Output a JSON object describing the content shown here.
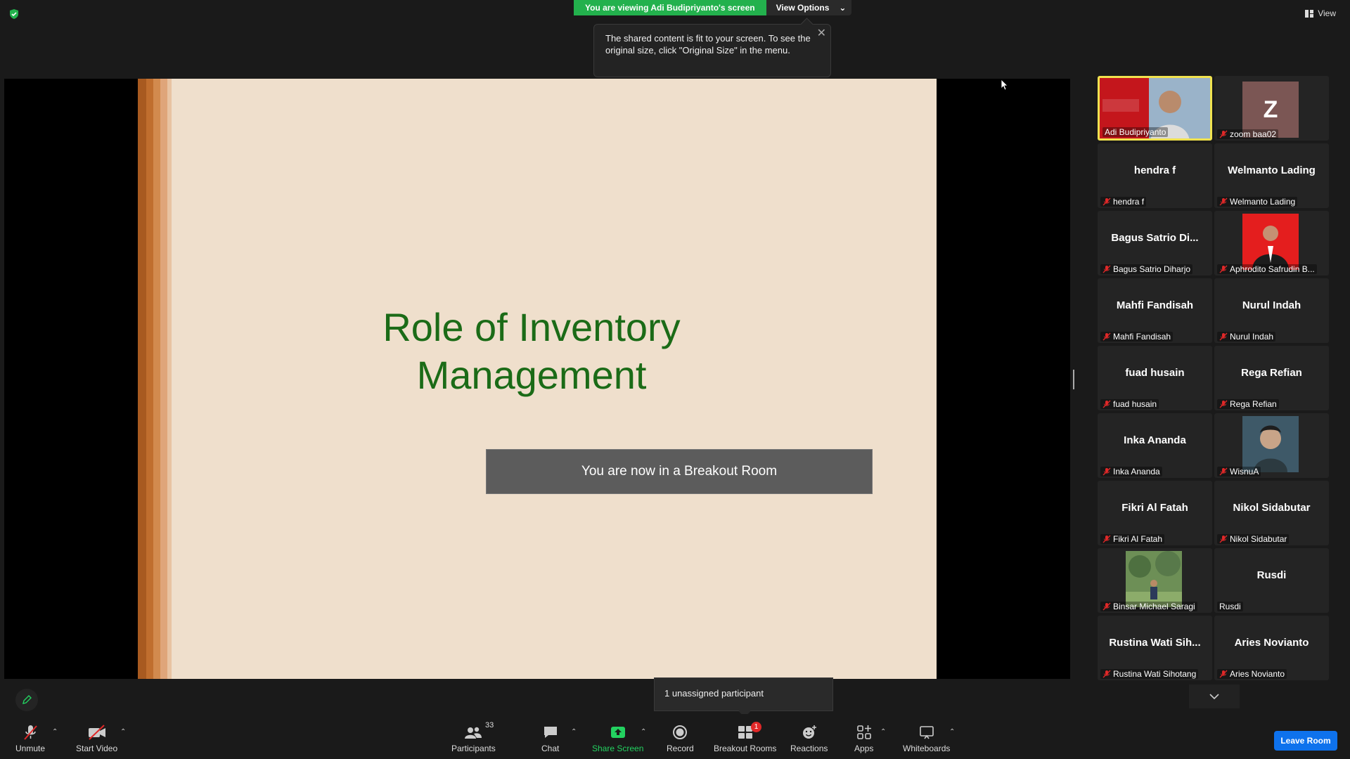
{
  "banner": {
    "viewing_text": "You are viewing Adi Budipriyanto's screen",
    "view_options_label": "View Options"
  },
  "top_right": {
    "view_label": "View"
  },
  "tooltip": {
    "text": "The shared content is fit to your screen. To see the original size, click \"Original Size\" in the menu."
  },
  "slide": {
    "title_line1": "Role of Inventory",
    "title_line2": "Management"
  },
  "breakout_notice": "You are now in a Breakout Room",
  "gallery": {
    "tiles": [
      {
        "display": "photo",
        "label": "Adi Budipriyanto",
        "muted": false,
        "active": true
      },
      {
        "display": "Z",
        "label": "zoom baa02",
        "muted": true
      },
      {
        "display": "hendra f",
        "label": "hendra f",
        "muted": true
      },
      {
        "display": "Welmanto Lading",
        "label": "Welmanto Lading",
        "muted": true
      },
      {
        "display": "Bagus Satrio Di...",
        "label": "Bagus Satrio Diharjo",
        "muted": true
      },
      {
        "display": "photo",
        "label": "Aphrodito Safrudin B...",
        "muted": true
      },
      {
        "display": "Mahfi Fandisah",
        "label": "Mahfi Fandisah",
        "muted": true
      },
      {
        "display": "Nurul Indah",
        "label": "Nurul Indah",
        "muted": true
      },
      {
        "display": "fuad husain",
        "label": "fuad husain",
        "muted": true
      },
      {
        "display": "Rega Refian",
        "label": "Rega Refian",
        "muted": true
      },
      {
        "display": "Inka Ananda",
        "label": "Inka Ananda",
        "muted": true
      },
      {
        "display": "photo",
        "label": "WisnuA",
        "muted": true
      },
      {
        "display": "Fikri Al Fatah",
        "label": "Fikri Al Fatah",
        "muted": true
      },
      {
        "display": "Nikol Sidabutar",
        "label": "Nikol Sidabutar",
        "muted": true
      },
      {
        "display": "photo",
        "label": "Binsar Michael Saragi",
        "muted": true
      },
      {
        "display": "Rusdi",
        "label": "Rusdi",
        "muted": false
      },
      {
        "display": "Rustina Wati Sih...",
        "label": "Rustina Wati Sihotang",
        "muted": true
      },
      {
        "display": "Aries Novianto",
        "label": "Aries Novianto",
        "muted": true
      }
    ]
  },
  "unassigned_popup": "1 unassigned participant",
  "toolbar": {
    "unmute": "Unmute",
    "start_video": "Start Video",
    "participants": "Participants",
    "participants_count": "33",
    "chat": "Chat",
    "share_screen": "Share Screen",
    "record": "Record",
    "breakout_rooms": "Breakout Rooms",
    "breakout_badge": "1",
    "reactions": "Reactions",
    "apps": "Apps",
    "whiteboards": "Whiteboards",
    "leave_room": "Leave Room"
  },
  "colors": {
    "share_green": "#23b14d",
    "slide_bg": "#efdfcc",
    "title_green": "#1b6b17",
    "active_speaker": "#f0e24e",
    "leave_blue": "#0e72ed",
    "badge_red": "#e02828"
  }
}
